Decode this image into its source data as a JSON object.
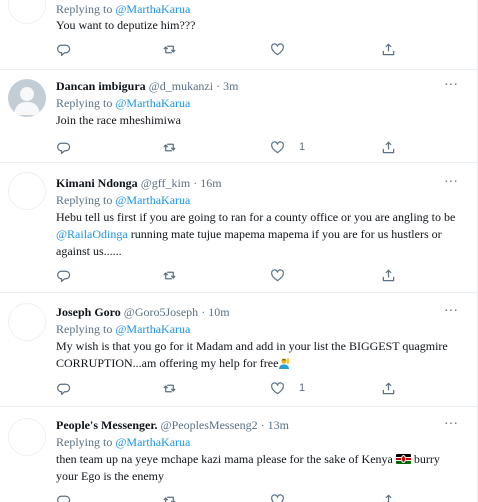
{
  "tweets": [
    {
      "avatar": "blank",
      "name": "",
      "handle": "",
      "time": "",
      "replying_prefix": "Replying to",
      "replying_to": "@MarthaKarua",
      "body_parts": [
        {
          "text": "You want to deputize him???"
        }
      ],
      "likes": ""
    },
    {
      "avatar": "default-profile",
      "name": "Dancan imbigura",
      "handle": "@d_mukanzi",
      "dot": "·",
      "time": "3m",
      "replying_prefix": "Replying to",
      "replying_to": "@MarthaKarua",
      "body_parts": [
        {
          "text": "Join the race mheshimiwa"
        }
      ],
      "likes": "1"
    },
    {
      "avatar": "blank",
      "name": "Kimani Ndonga",
      "handle": "@gff_kim",
      "dot": "·",
      "time": "16m",
      "replying_prefix": "Replying to",
      "replying_to": "@MarthaKarua",
      "body_parts": [
        {
          "text": "Hebu tell us first if you are going to ran for a county office or you are angling to be "
        },
        {
          "text": "@RailaOdinga",
          "link": true
        },
        {
          "text": " running mate tujue mapema mapema if you are for us hustlers or against us......"
        }
      ],
      "likes": ""
    },
    {
      "avatar": "blank",
      "name": "Joseph Goro",
      "handle": "@Goro5Joseph",
      "dot": "·",
      "time": "10m",
      "replying_prefix": "Replying to",
      "replying_to": "@MarthaKarua",
      "body_parts": [
        {
          "text": "My wish is that you go for it Madam and add in your list the BIGGEST quagmire CORRUPTION...am offering my help for free"
        },
        {
          "emoji": "person-raising-hand"
        }
      ],
      "likes": "1"
    },
    {
      "avatar": "blank",
      "name": "People's Messenger.",
      "handle": "@PeoplesMesseng2",
      "dot": "·",
      "time": "13m",
      "replying_prefix": "Replying to",
      "replying_to": "@MarthaKarua",
      "body_parts": [
        {
          "text": "then team up na yeye mchape kazi mama please for the sake of Kenya "
        },
        {
          "emoji": "kenya-flag"
        },
        {
          "text": " burry your Ego is the enemy"
        }
      ],
      "likes": ""
    }
  ],
  "icons": {
    "reply": "reply-icon",
    "retweet": "retweet-icon",
    "like": "like-icon",
    "share": "share-icon",
    "more": "more-icon"
  },
  "colors": {
    "link": "#1b95e0",
    "muted": "#5b7083",
    "divider": "#e6ecf0"
  }
}
